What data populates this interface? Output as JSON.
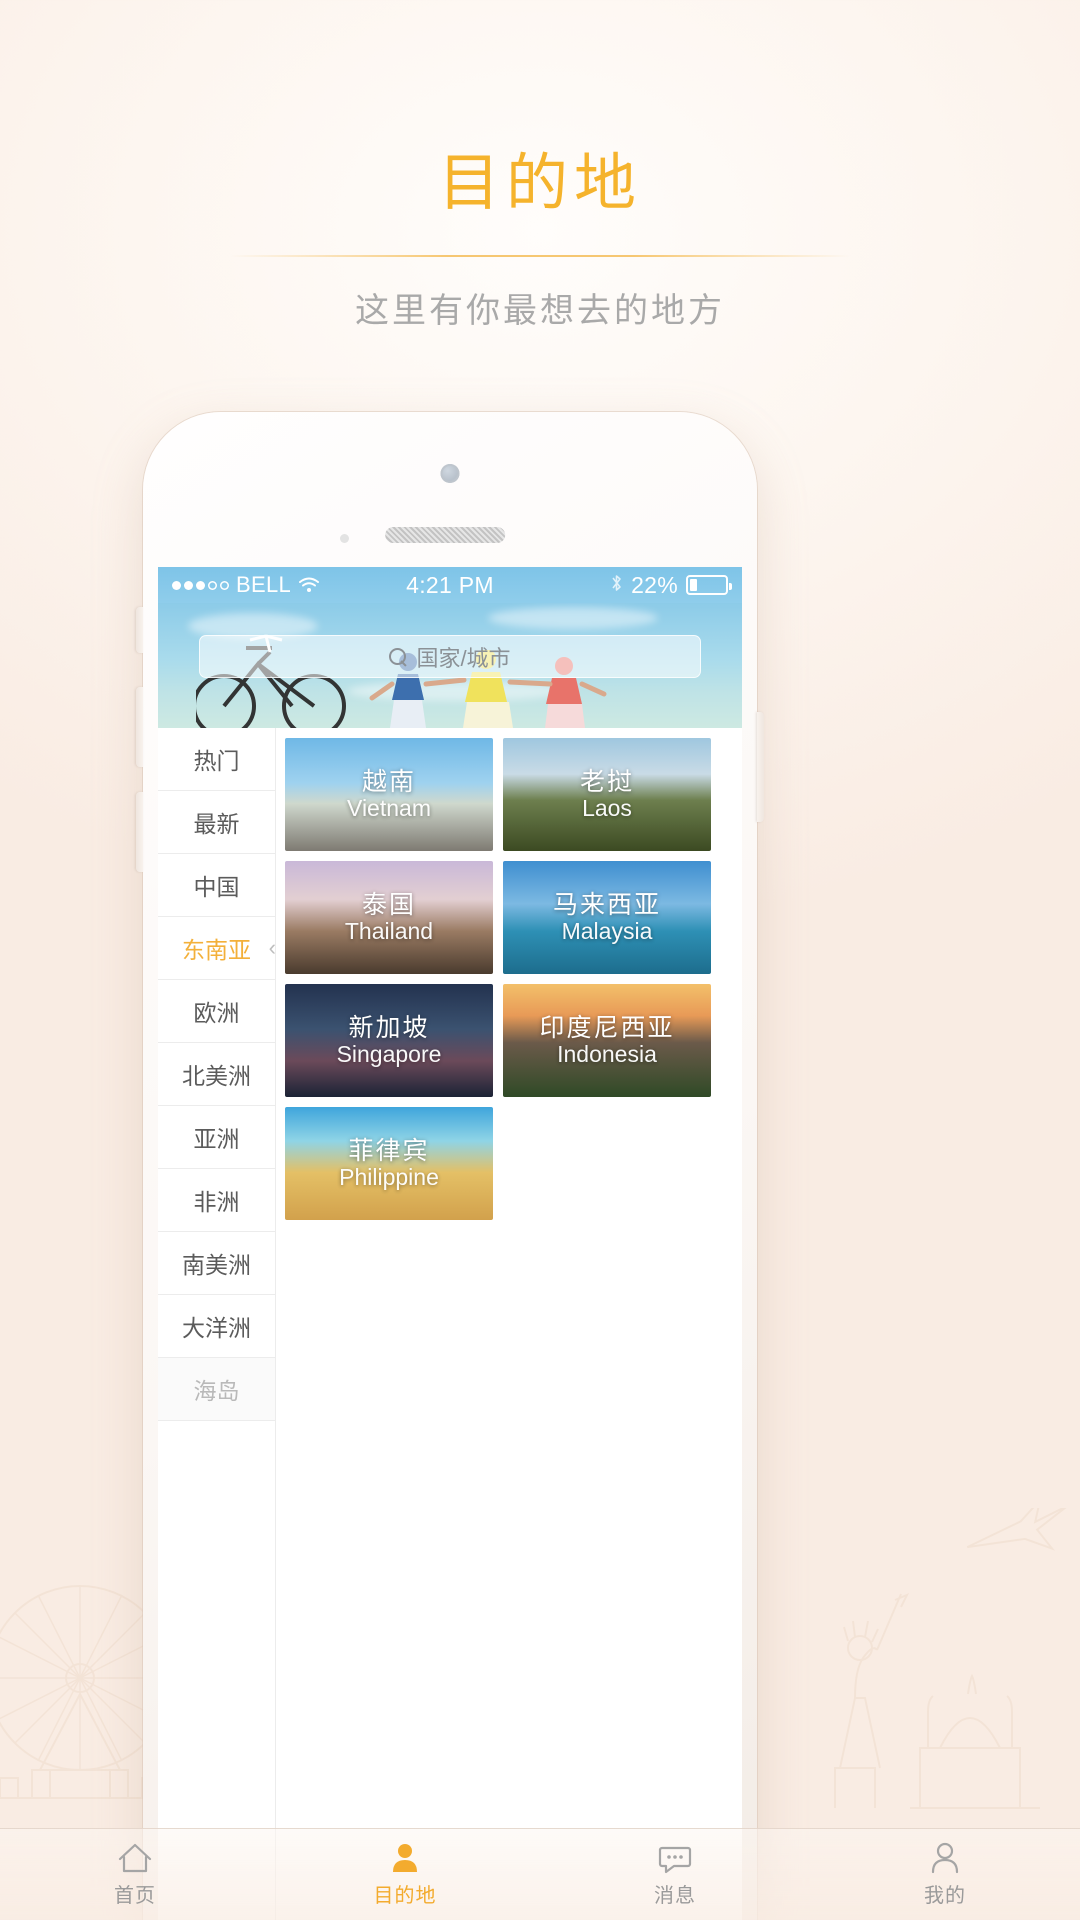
{
  "header": {
    "title": "目的地",
    "subtitle": "这里有你最想去的地方"
  },
  "colors": {
    "accent": "#f5b32c",
    "subtitle": "#a9a9a9",
    "category_active": "#f3b03a",
    "statusbar_bg": "#8fcdeb"
  },
  "phone": {
    "statusbar": {
      "carrier": "BELL",
      "signal_icon": "signal-dots-icon",
      "wifi_icon": "wifi-icon",
      "time": "4:21 PM",
      "bluetooth_icon": "bluetooth-icon",
      "battery_percent": "22%",
      "battery_level": 22
    },
    "search": {
      "icon": "search-icon",
      "placeholder": "国家/城市",
      "value": ""
    },
    "categories": [
      {
        "label": "热门",
        "state": "normal"
      },
      {
        "label": "最新",
        "state": "normal"
      },
      {
        "label": "中国",
        "state": "normal"
      },
      {
        "label": "东南亚",
        "state": "active"
      },
      {
        "label": "欧洲",
        "state": "normal"
      },
      {
        "label": "北美洲",
        "state": "normal"
      },
      {
        "label": "亚洲",
        "state": "normal"
      },
      {
        "label": "非洲",
        "state": "normal"
      },
      {
        "label": "南美洲",
        "state": "normal"
      },
      {
        "label": "大洋洲",
        "state": "normal"
      },
      {
        "label": "海岛",
        "state": "dim"
      }
    ],
    "destinations": [
      {
        "cn": "越南",
        "en": "Vietnam",
        "theme": "bg-vietnam"
      },
      {
        "cn": "老挝",
        "en": "Laos",
        "theme": "bg-laos"
      },
      {
        "cn": "泰国",
        "en": "Thailand",
        "theme": "bg-thai"
      },
      {
        "cn": "马来西亚",
        "en": "Malaysia",
        "theme": "bg-malay"
      },
      {
        "cn": "新加坡",
        "en": "Singapore",
        "theme": "bg-sing"
      },
      {
        "cn": "印度尼西亚",
        "en": "Indonesia",
        "theme": "bg-indo"
      },
      {
        "cn": "菲律宾",
        "en": "Philippine",
        "theme": "bg-phil"
      }
    ]
  },
  "tabbar": [
    {
      "label": "首页",
      "icon": "home-icon",
      "state": "normal"
    },
    {
      "label": "目的地",
      "icon": "destination-icon",
      "state": "active"
    },
    {
      "label": "消息",
      "icon": "message-icon",
      "state": "normal"
    },
    {
      "label": "我的",
      "icon": "profile-icon",
      "state": "normal"
    }
  ]
}
